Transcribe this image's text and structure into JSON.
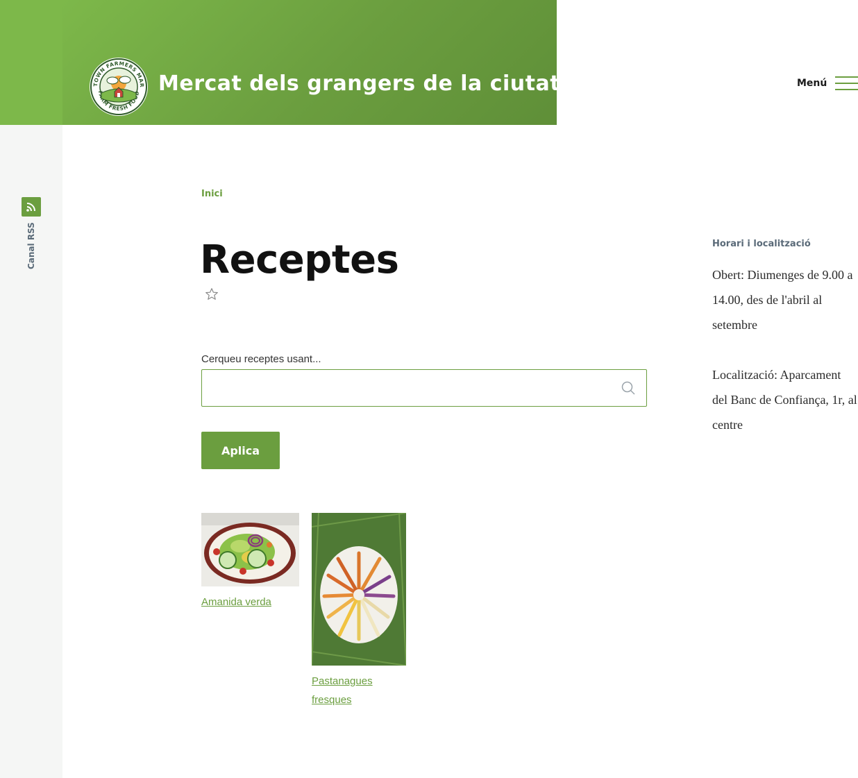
{
  "site": {
    "title": "Mercat dels grangers de la ciutat",
    "logo": {
      "ring_top": "ANYTOWN FARMERS MARKET",
      "ring_bottom": "FARM FRESH FOOD"
    }
  },
  "header": {
    "menu_label": "Menú"
  },
  "rss": {
    "label": "Canal RSS",
    "icon": "rss-icon"
  },
  "breadcrumb": {
    "home": "Inici"
  },
  "page": {
    "title": "Receptes",
    "favorite_icon": "star-outline-icon"
  },
  "search": {
    "label": "Cerqueu receptes usant...",
    "value": "",
    "placeholder": "",
    "icon": "search-icon",
    "apply_label": "Aplica"
  },
  "recipes": [
    {
      "title": "Amanida verda",
      "image": "green-salad-plate"
    },
    {
      "title": "Pastanagues fresques",
      "image": "rainbow-carrots"
    }
  ],
  "sidebar": {
    "heading": "Horari i localització",
    "hours": "Obert: Diumenges de 9.00 a 14.00, des de l'abril al setembre",
    "location": "Localització: Aparcament del Banc de Confiança, 1r, al centre"
  },
  "colors": {
    "accent": "#6b9e3f",
    "header_light": "#7db84a",
    "muted_text": "#5a6a78"
  }
}
